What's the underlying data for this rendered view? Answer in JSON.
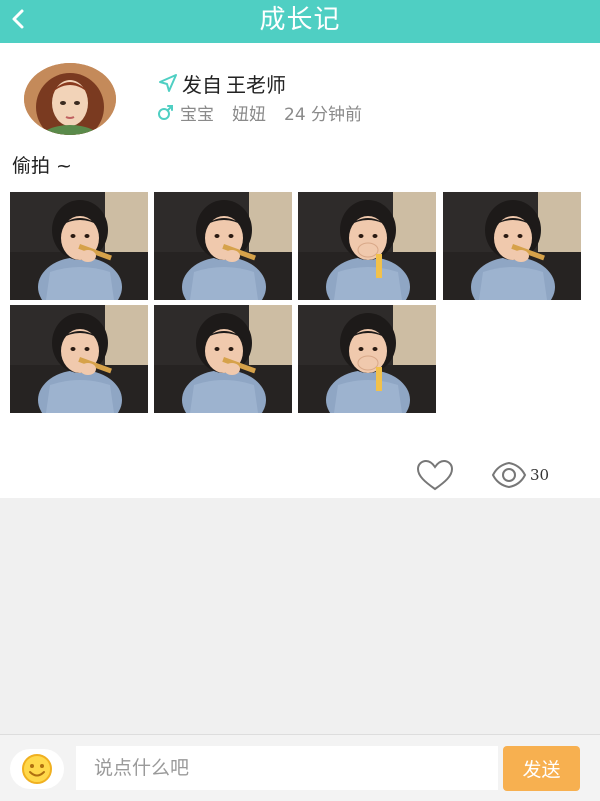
{
  "header": {
    "title": "成长记",
    "back_icon": "chevron-left-icon"
  },
  "post": {
    "author_prefix": "发自",
    "author": "王老师",
    "send_icon": "send-arrow-icon",
    "gender_icon": "male-symbol-icon",
    "tags": [
      "宝宝",
      "妞妞"
    ],
    "time": "24 分钟前",
    "content": "偷拍 ~",
    "photos": [
      {
        "variant": "eating"
      },
      {
        "variant": "eating"
      },
      {
        "variant": "covering"
      },
      {
        "variant": "eating"
      },
      {
        "variant": "eating"
      },
      {
        "variant": "eating"
      },
      {
        "variant": "covering"
      }
    ],
    "like_icon": "heart-icon",
    "views_icon": "eye-icon",
    "views": "30"
  },
  "comment": {
    "emoji_icon": "smiley-icon",
    "placeholder": "说点什么吧",
    "send_label": "发送"
  },
  "colors": {
    "accent": "#4fcfc3",
    "send": "#f7b050"
  }
}
